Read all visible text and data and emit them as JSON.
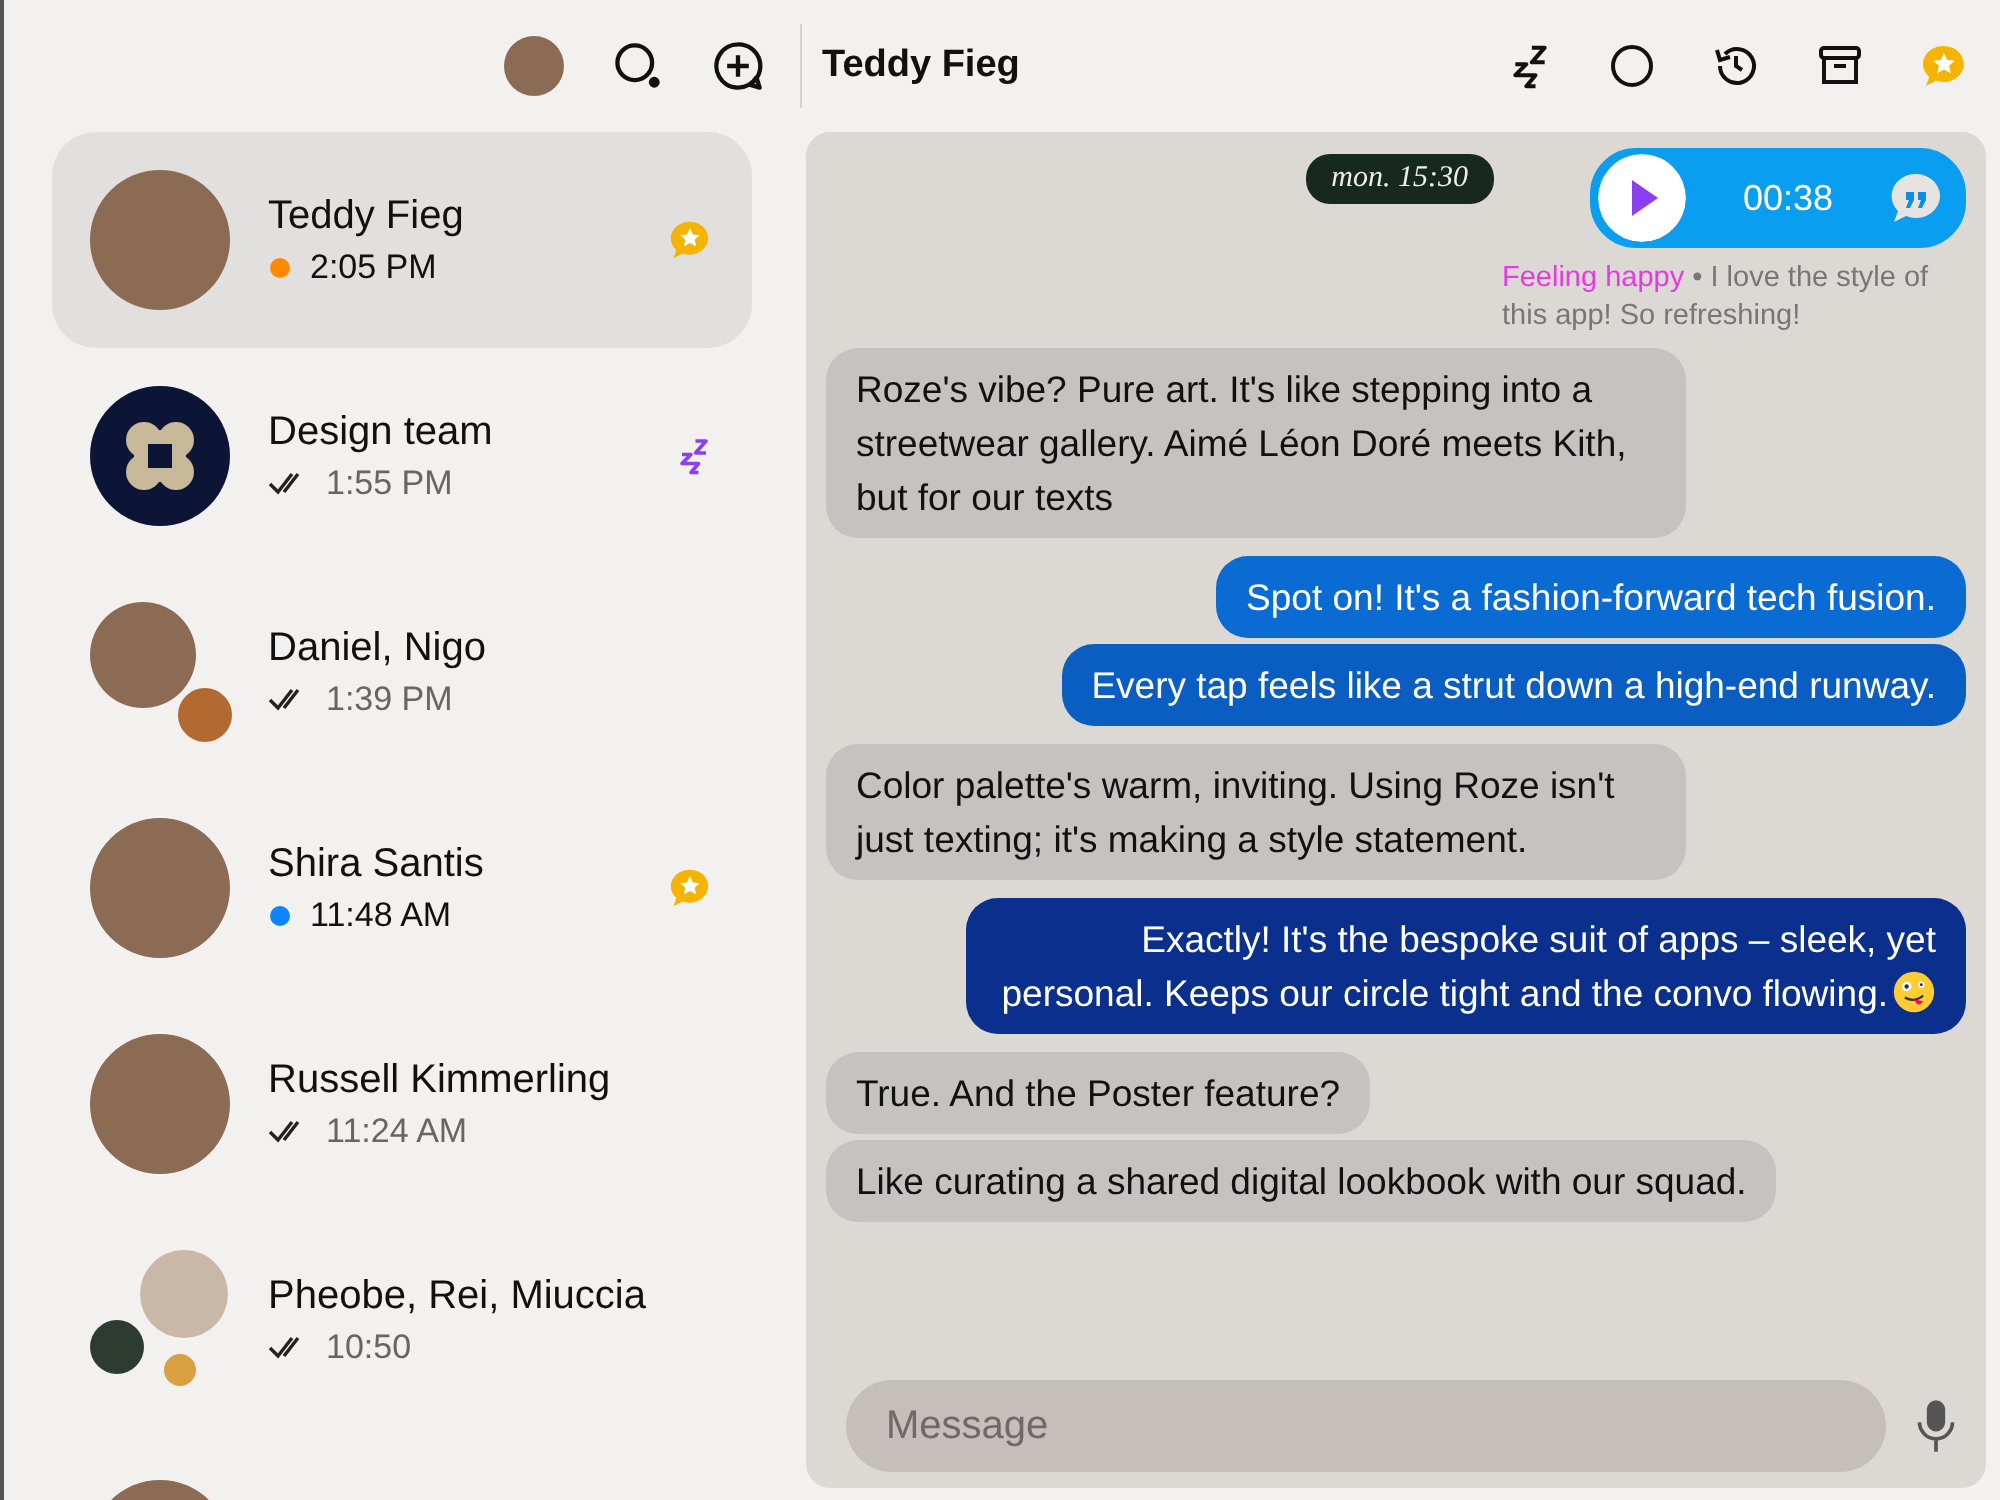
{
  "toolbar": {
    "title": "Teddy Fieg"
  },
  "conversations": [
    {
      "name": "Teddy Fieg",
      "time": "2:05 PM",
      "status": {
        "kind": "dot",
        "color": "#ff8a00"
      },
      "badge": {
        "kind": "star"
      },
      "avatar": {
        "kind": "single"
      },
      "selected": true
    },
    {
      "name": "Design team",
      "time": "1:55 PM",
      "status": {
        "kind": "read"
      },
      "badge": {
        "kind": "snooze"
      },
      "avatar": {
        "kind": "logo"
      },
      "selected": false
    },
    {
      "name": "Daniel, Nigo",
      "time": "1:39 PM",
      "status": {
        "kind": "read"
      },
      "avatar": {
        "kind": "duo"
      },
      "selected": false
    },
    {
      "name": "Shira Santis",
      "time": "11:48 AM",
      "status": {
        "kind": "dot",
        "color": "#0a84ff"
      },
      "badge": {
        "kind": "star"
      },
      "avatar": {
        "kind": "single"
      },
      "selected": false
    },
    {
      "name": "Russell Kimmerling",
      "time": "11:24 AM",
      "status": {
        "kind": "read"
      },
      "avatar": {
        "kind": "single"
      },
      "selected": false
    },
    {
      "name": "Pheobe, Rei, Miuccia",
      "time": "10:50",
      "status": {
        "kind": "read"
      },
      "avatar": {
        "kind": "trio"
      },
      "selected": false
    }
  ],
  "more_below": true,
  "chat": {
    "voice_message": {
      "timestamp": "mon. 15:30",
      "duration": "00:38",
      "mood": "Feeling happy",
      "caption": "• I love the style of this app! So refreshing!"
    },
    "messages": [
      {
        "kind": "incoming",
        "text": "Roze's vibe? Pure art. It's like stepping into a streetwear gallery. Aimé Léon Doré meets Kith, but for our texts"
      },
      {
        "kind": "outgoing",
        "color": "#0a6bd3",
        "text": "Spot on! It's a fashion-forward tech fusion."
      },
      {
        "kind": "outgoing",
        "color": "#0a5ec2",
        "text": "Every tap feels like a strut down a high-end runway."
      },
      {
        "kind": "incoming",
        "text": "Color palette's warm, inviting. Using Roze isn't just texting; it's making a style statement."
      },
      {
        "kind": "outgoing",
        "color": "#0b2f8c",
        "emoji": true,
        "text": "Exactly! It's the bespoke suit of apps – sleek, yet personal.  Keeps our circle tight and the convo flowing."
      },
      {
        "kind": "incoming",
        "text": "True. And the Poster feature?"
      },
      {
        "kind": "incoming",
        "text": "Like curating a shared digital lookbook with our squad."
      }
    ],
    "composer": {
      "placeholder": "Message"
    }
  }
}
